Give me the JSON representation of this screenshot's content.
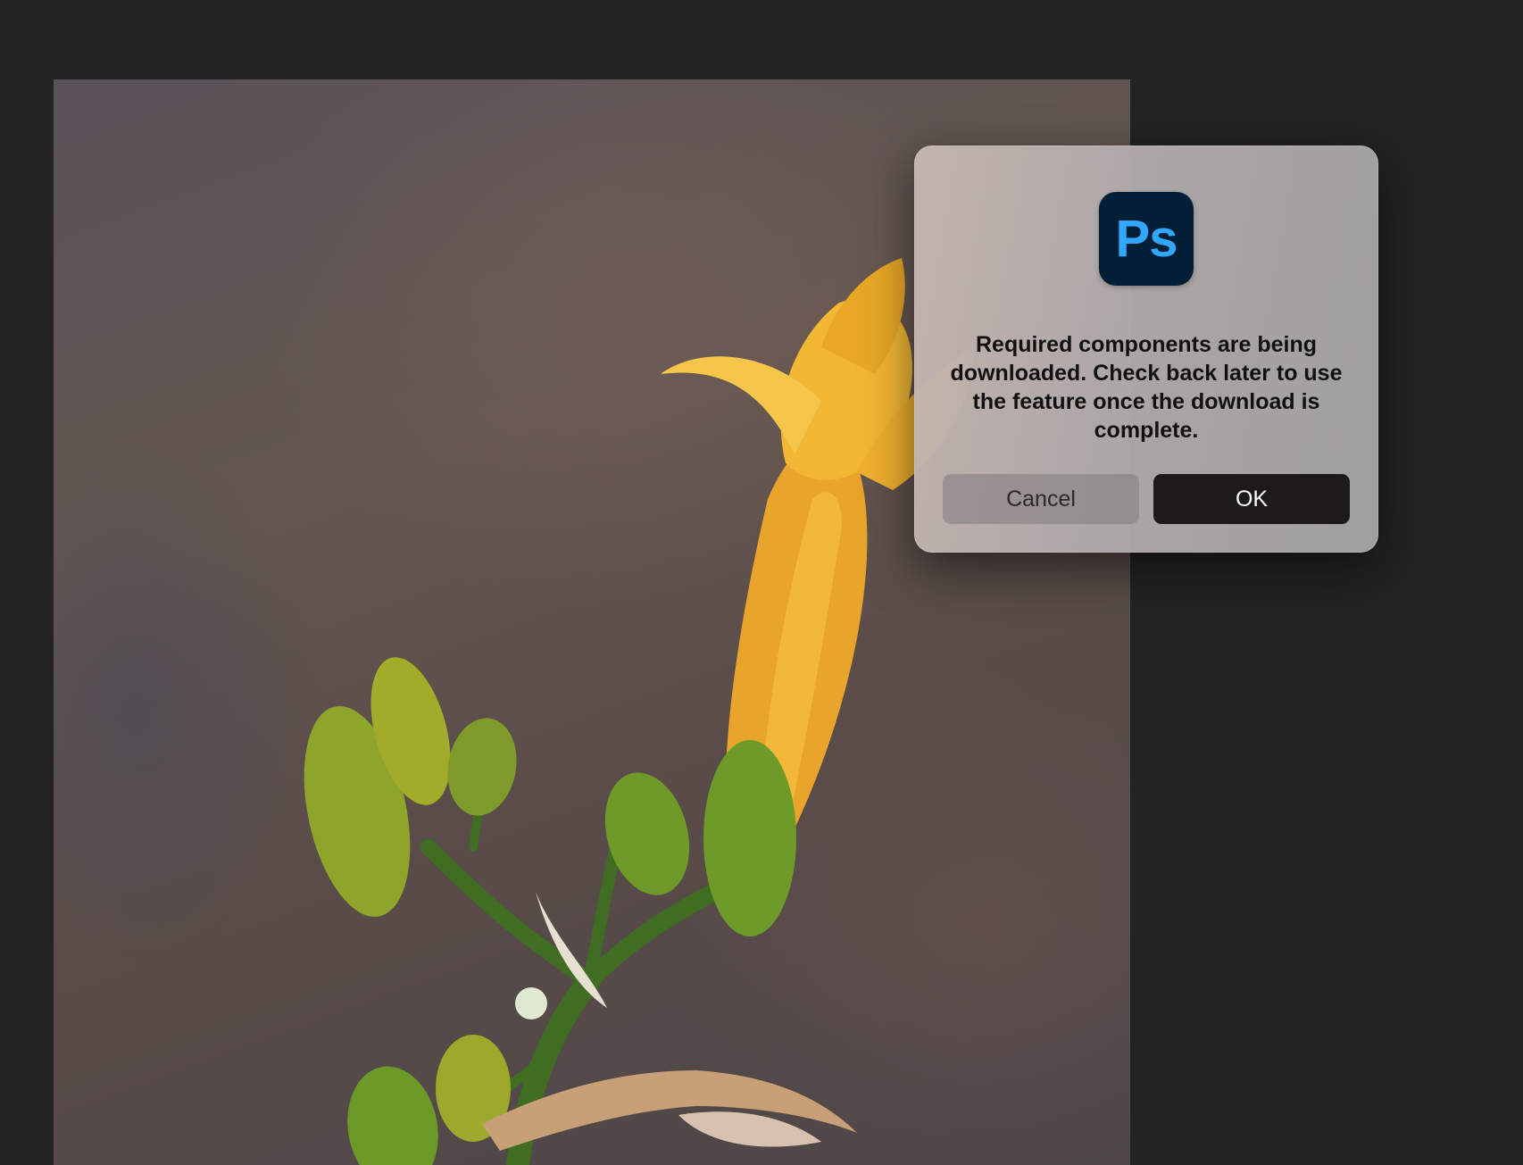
{
  "dialog": {
    "app_icon_text": "Ps",
    "message": "Required components are being downloaded. Check back later to use the feature once the download is complete.",
    "cancel_label": "Cancel",
    "ok_label": "OK"
  },
  "colors": {
    "app_background": "#232323",
    "ps_icon_background": "#001e36",
    "ps_icon_text": "#31a8ff",
    "ok_button": "#1d1b1a"
  }
}
